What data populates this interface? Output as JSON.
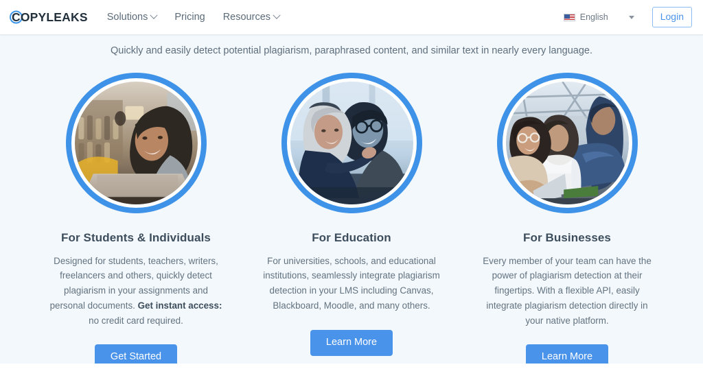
{
  "header": {
    "logo_text": "COPYLEAKS",
    "logo_icon": "copyleaks-circle-logo",
    "nav": [
      {
        "label": "Solutions",
        "has_dropdown": true
      },
      {
        "label": "Pricing",
        "has_dropdown": false
      },
      {
        "label": "Resources",
        "has_dropdown": true
      }
    ],
    "language": {
      "label": "English",
      "flag_icon": "us-flag-icon",
      "caret_icon": "caret-down-icon"
    },
    "login_label": "Login"
  },
  "main": {
    "subtitle": "Quickly and easily detect potential plagiarism, paraphrased content, and similar text in nearly every language.",
    "cards": [
      {
        "image_name": "student-with-laptop-photo",
        "title": "For Students & Individuals",
        "desc_lead": "Designed for students, teachers, writers, freelancers and others, quickly detect plagiarism in your assignments and personal documents. ",
        "desc_bold": "Get instant access:",
        "desc_tail": " no credit card required.",
        "cta_label": "Get Started"
      },
      {
        "image_name": "two-educators-photo",
        "title": "For Education",
        "desc_lead": "For universities, schools, and educational institutions, seamlessly integrate plagiarism detection in your LMS including Canvas, Blackboard, Moodle, and many others.",
        "desc_bold": "",
        "desc_tail": "",
        "cta_label": "Learn More"
      },
      {
        "image_name": "business-team-meeting-photo",
        "title": "For Businesses",
        "desc_lead": "Every member of your team can have the power of plagiarism detection at their fingertips.  With a flexible API, easily integrate plagiarism detection directly in your native platform.",
        "desc_bold": "",
        "desc_tail": "",
        "cta_label": "Learn More"
      }
    ]
  },
  "colors": {
    "brand_blue": "#4a93ea",
    "ring_blue": "#3e93e8",
    "page_bg": "#f3f8fc",
    "header_bg": "#ffffff",
    "heading_text": "#3d4d5c",
    "body_text": "#62727f",
    "login_border": "#8cbdf2"
  }
}
